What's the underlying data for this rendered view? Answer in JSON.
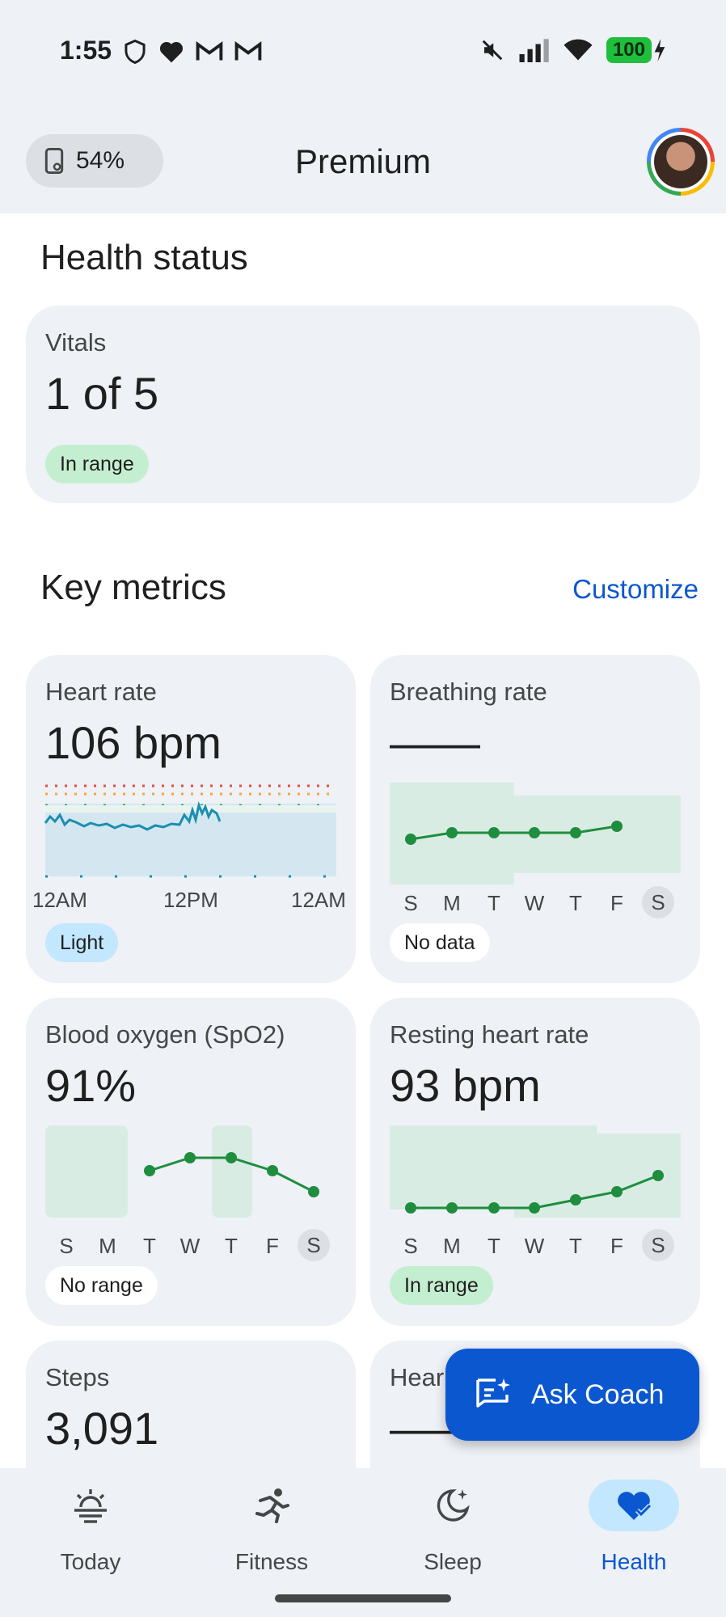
{
  "status_bar": {
    "time": "1:55",
    "battery": "100"
  },
  "top_bar": {
    "battery_percent": "54%",
    "title": "Premium"
  },
  "health_status": {
    "title": "Health status",
    "vitals": {
      "label": "Vitals",
      "value": "1 of 5",
      "badge": "In range"
    }
  },
  "key_metrics": {
    "title": "Key metrics",
    "customize_label": "Customize",
    "heart_rate": {
      "label": "Heart rate",
      "value": "106 bpm",
      "badge": "Light",
      "time_labels": [
        "12AM",
        "12PM",
        "12AM"
      ]
    },
    "breathing_rate": {
      "label": "Breathing rate",
      "value": "——",
      "badge": "No data",
      "days": [
        "S",
        "M",
        "T",
        "W",
        "T",
        "F",
        "S"
      ]
    },
    "blood_oxygen": {
      "label": "Blood oxygen (SpO2)",
      "value": "91%",
      "badge": "No range",
      "days": [
        "S",
        "M",
        "T",
        "W",
        "T",
        "F",
        "S"
      ]
    },
    "resting_heart_rate": {
      "label": "Resting heart rate",
      "value": "93 bpm",
      "badge": "In range",
      "days": [
        "S",
        "M",
        "T",
        "W",
        "T",
        "F",
        "S"
      ]
    },
    "steps": {
      "label": "Steps",
      "value": "3,091"
    },
    "heart_partial": {
      "label": "Hear",
      "value": "——"
    }
  },
  "fab": {
    "label": "Ask Coach"
  },
  "bottom_nav": {
    "items": [
      {
        "label": "Today",
        "icon": "sun-horizon-icon"
      },
      {
        "label": "Fitness",
        "icon": "running-person-icon"
      },
      {
        "label": "Sleep",
        "icon": "moon-icon"
      },
      {
        "label": "Health",
        "icon": "heart-check-icon",
        "active": true
      }
    ]
  },
  "colors": {
    "accent": "#0b57d0",
    "trend_green": "#1e8e3e",
    "heart_line": "#1a8fb0",
    "in_range_badge": "#c4eed0",
    "light_badge": "#c2e7ff"
  }
}
